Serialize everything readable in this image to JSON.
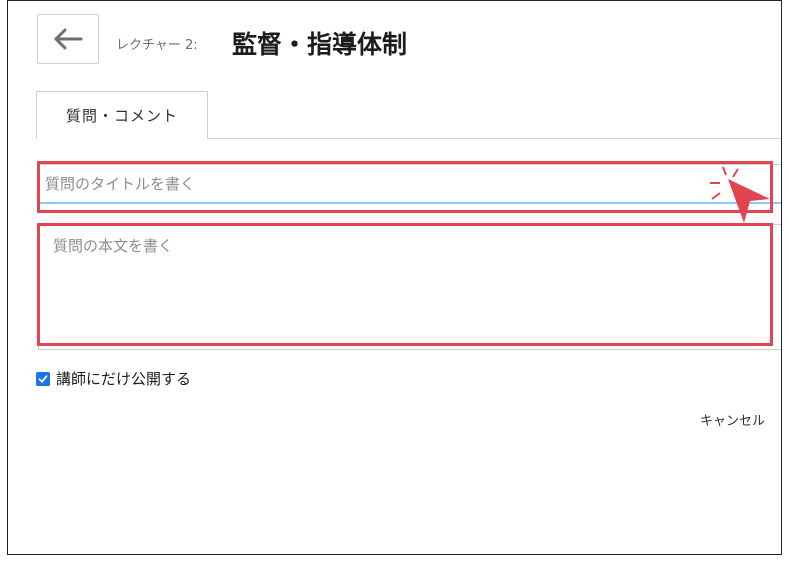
{
  "header": {
    "back_icon": "arrow-left-icon",
    "lecture_prefix": "レクチャー 2:",
    "lecture_title": "監督・指導体制"
  },
  "tabs": [
    {
      "label": "質問・コメント"
    }
  ],
  "form": {
    "title_placeholder": "質問のタイトルを書く",
    "body_placeholder": "質問の本文を書く",
    "checkbox_label": "講師にだけ公開する",
    "checkbox_checked": true,
    "cancel_label": "キャンセル"
  },
  "colors": {
    "highlight": "#e14552",
    "checkbox": "#1a73e8",
    "input_focus": "#8ec7f0"
  }
}
